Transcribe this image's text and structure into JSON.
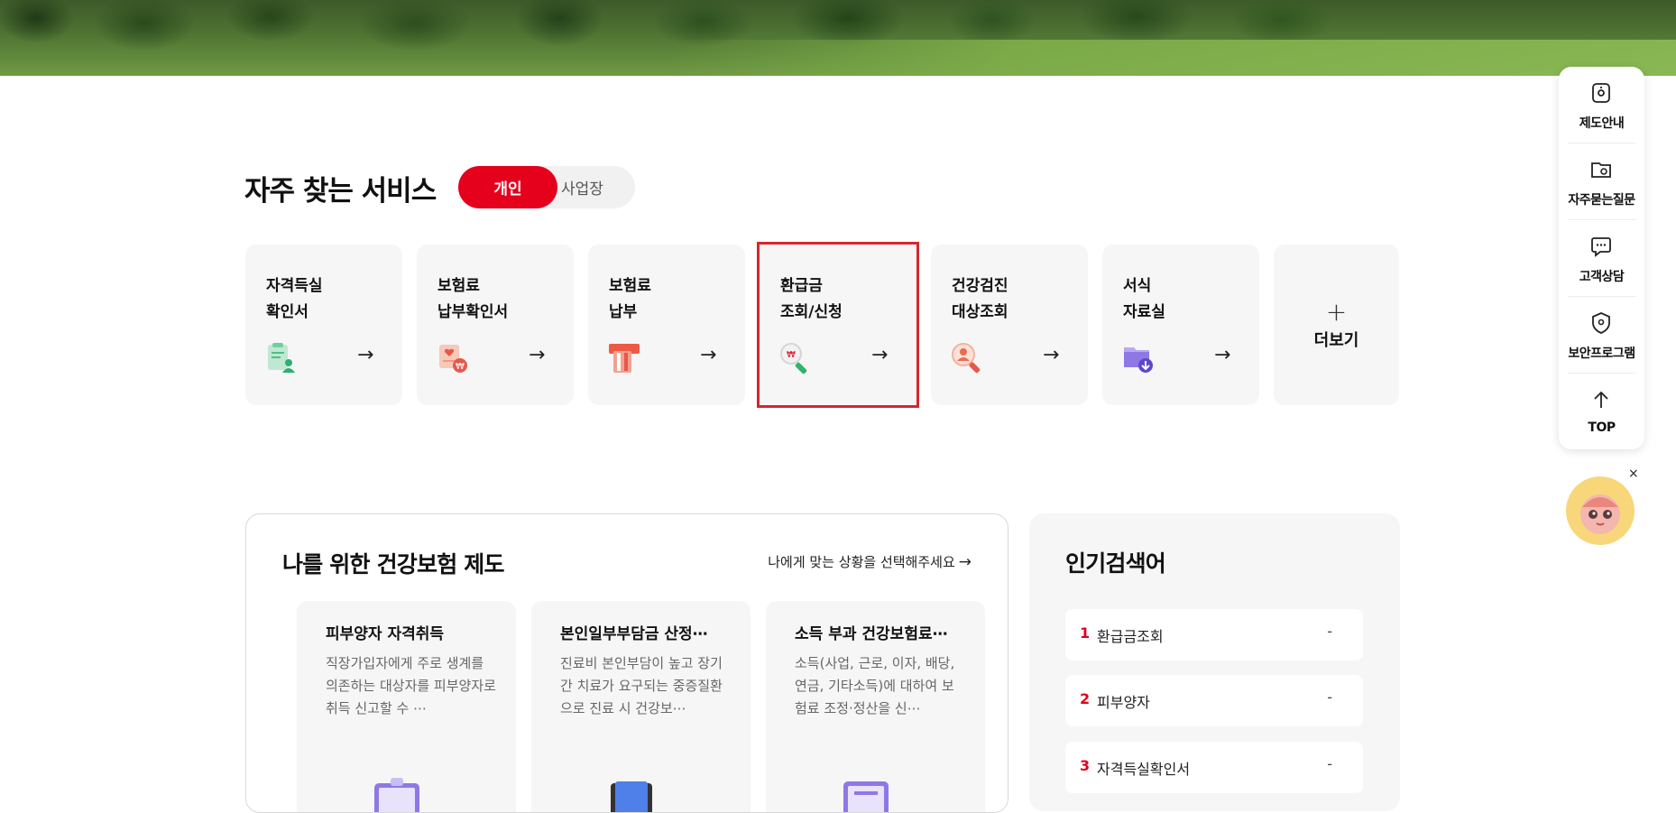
{
  "section": {
    "title": "자주 찾는 서비스",
    "toggle": {
      "active": "개인",
      "inactive": "사업장"
    }
  },
  "services": [
    {
      "label": "자격득실\n확인서",
      "icon": "certificate-person-icon",
      "arrow": "→"
    },
    {
      "label": "보험료\n납부확인서",
      "icon": "payment-doc-icon",
      "arrow": "→"
    },
    {
      "label": "보험료\n납부",
      "icon": "card-payment-icon",
      "arrow": "→"
    },
    {
      "label": "환급금\n조회/신청",
      "icon": "refund-search-icon",
      "arrow": "→"
    },
    {
      "label": "건강검진\n대상조회",
      "icon": "person-search-icon",
      "arrow": "→"
    },
    {
      "label": "서식\n자료실",
      "icon": "folder-download-icon",
      "arrow": "→"
    }
  ],
  "more": {
    "plus": "+",
    "label": "더보기"
  },
  "quickbar": [
    {
      "label": "제도안내",
      "icon": "guide-icon"
    },
    {
      "label": "자주묻는질문",
      "icon": "faq-folder-icon"
    },
    {
      "label": "고객상담",
      "icon": "chat-icon"
    },
    {
      "label": "보안프로그램",
      "icon": "shield-icon"
    },
    {
      "label": "TOP",
      "icon": "arrow-up-icon"
    }
  ],
  "mascot": {
    "close": "×"
  },
  "insurance": {
    "title": "나를 위한 건강보험 제도",
    "link": "나에게 맞는 상황을 선택해주세요",
    "link_arrow": "→",
    "cards": [
      {
        "title": "피부양자 자격취득",
        "desc": "직장가입자에게 주로 생계를 의존하는 대상자를 피부양자로 취득 신고할 수 ⋯"
      },
      {
        "title": "본인일부부담금 산정⋯",
        "desc": "진료비 본인부담이 높고 장기간 치료가 요구되는 중증질환으로 진료 시 건강보⋯"
      },
      {
        "title": "소득 부과 건강보험료⋯",
        "desc": "소득(사업, 근로, 이자, 배당, 연금, 기타소득)에 대하여 보험료 조정·정산을 신⋯"
      }
    ]
  },
  "popular": {
    "title": "인기검색어",
    "items": [
      {
        "rank": "1",
        "keyword": "환급금조회",
        "change": "-"
      },
      {
        "rank": "2",
        "keyword": "피부양자",
        "change": "-"
      },
      {
        "rank": "3",
        "keyword": "자격득실확인서",
        "change": "-"
      }
    ]
  },
  "colors": {
    "accent": "#e5001b",
    "highlight_border": "#d7262e",
    "card_bg": "#f6f6f6"
  }
}
